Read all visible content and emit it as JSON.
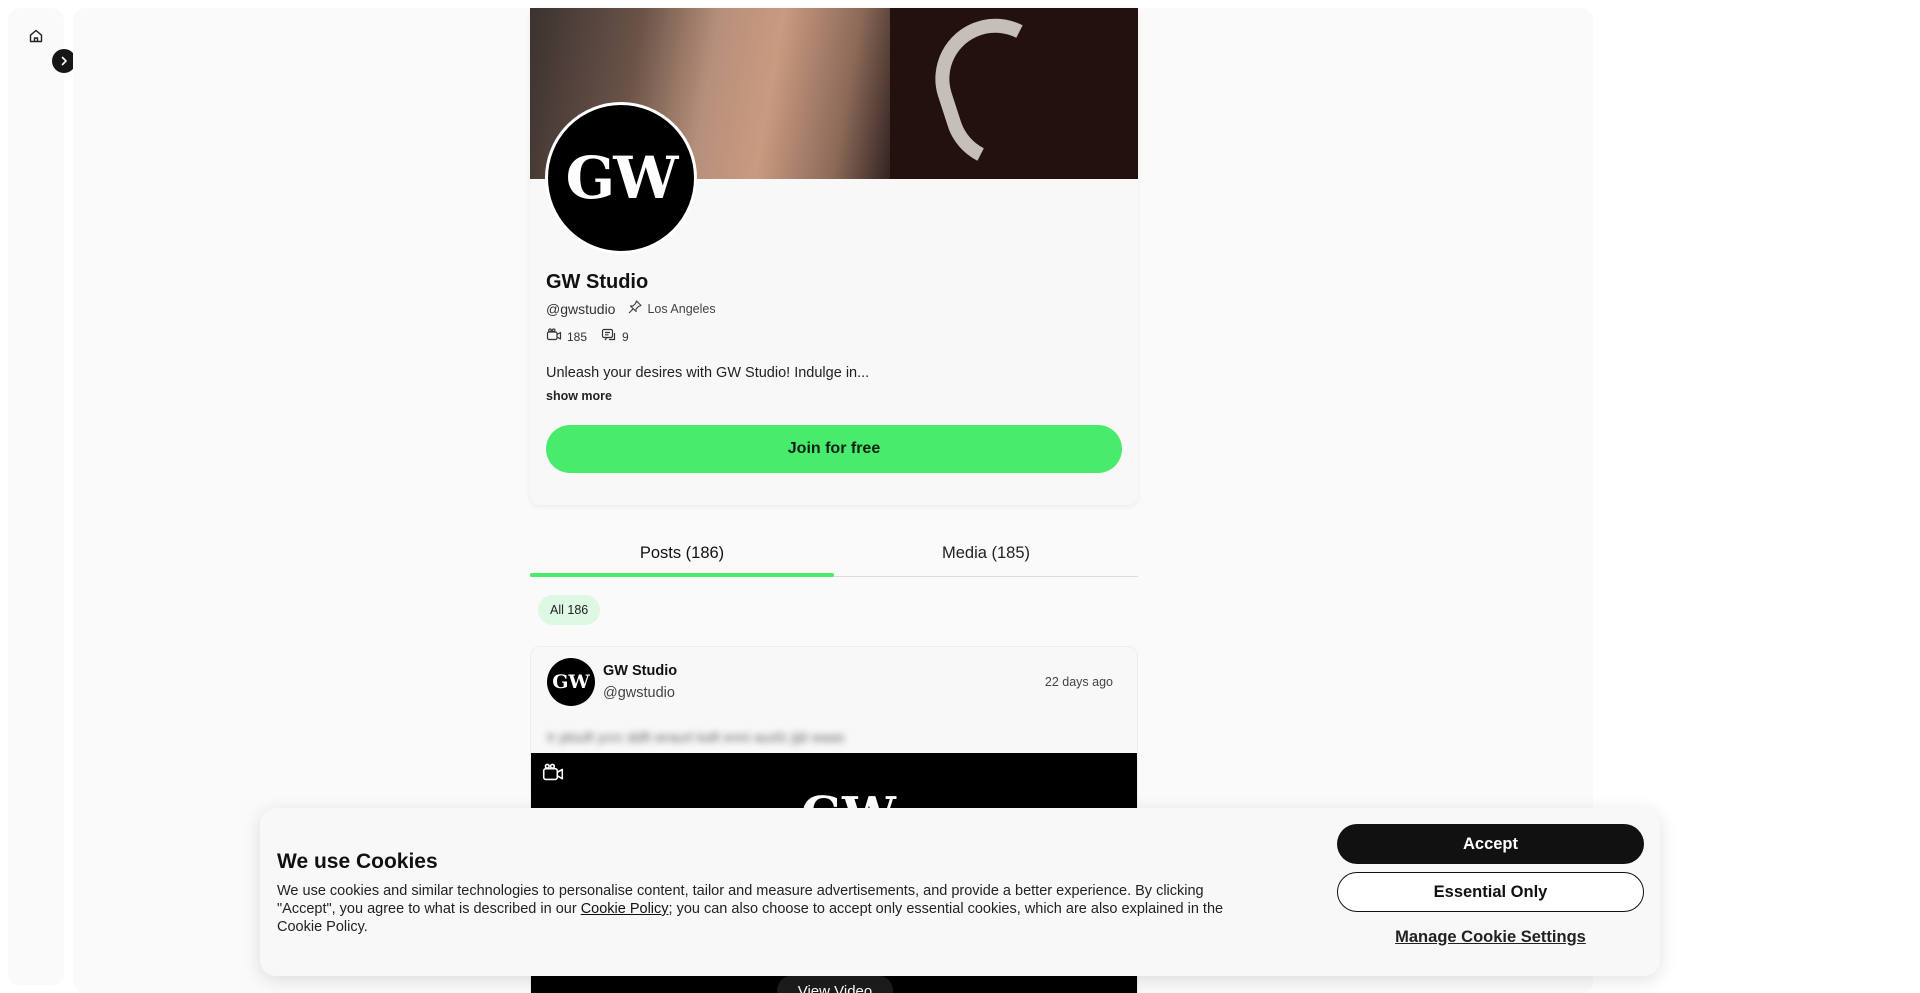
{
  "nav": {
    "home_icon": "home-icon",
    "expand_icon": "chevron-right-icon"
  },
  "profile": {
    "display_name": "GW Studio",
    "avatar_text": "GW",
    "handle": "@gwstudio",
    "location": "Los Angeles",
    "media_count": "185",
    "posts_count": "9",
    "bio": "Unleash your desires with GW Studio! Indulge in...",
    "show_more": "show more",
    "join_label": "Join for free"
  },
  "tabs": [
    {
      "label": "Posts (186)",
      "active": true
    },
    {
      "label": "Media (185)",
      "active": false
    }
  ],
  "filters": {
    "all_label": "All 186"
  },
  "post": {
    "author_name": "GW Studio",
    "author_handle": "@gwstudio",
    "time": "22 days ago",
    "blurred_text": "Ir plouft ycrc ddft wraurt kaft enni ausfz jijit waas",
    "media_logo": "GW",
    "view_video_label": "View Video"
  },
  "cookie": {
    "title": "We use Cookies",
    "text_before": "We use cookies and similar technologies to personalise content, tailor and measure advertisements, and provide a better experience. By clicking \"Accept\", you agree to what is described in our ",
    "link_label": "Cookie Policy",
    "text_after": "; you can also choose to accept only essential cookies, which are also explained in the Cookie Policy.",
    "accept_label": "Accept",
    "essential_label": "Essential Only",
    "manage_label": "Manage Cookie Settings"
  },
  "colors": {
    "accent": "#48eb6c",
    "chip_bg": "#ddf8e3",
    "dark": "#111111"
  }
}
